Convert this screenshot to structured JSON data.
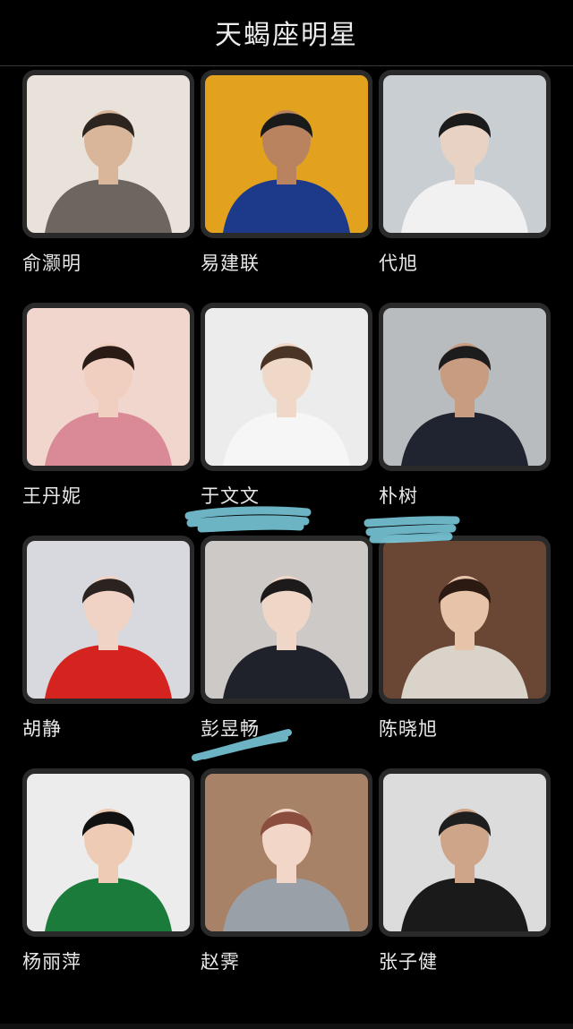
{
  "header": {
    "title": "天蝎座明星"
  },
  "celebrities": [
    {
      "name": "俞灏明",
      "bg": "#e8e2da",
      "skin": "#d9b59a",
      "hair": "#2b241f",
      "top": "#6d6560"
    },
    {
      "name": "易建联",
      "bg": "#e2a21e",
      "skin": "#b98360",
      "hair": "#1a1a1a",
      "top": "#1d3a8a"
    },
    {
      "name": "代旭",
      "bg": "#c9ced3",
      "skin": "#e7d2c4",
      "hair": "#1b1b1b",
      "top": "#f1f1f1"
    },
    {
      "name": "王丹妮",
      "bg": "#f0d6cc",
      "skin": "#f1cfc0",
      "hair": "#2a1b16",
      "top": "#d98a96"
    },
    {
      "name": "于文文",
      "bg": "#ececec",
      "skin": "#f0d8c8",
      "hair": "#4a3426",
      "top": "#f6f6f6"
    },
    {
      "name": "朴树",
      "bg": "#b9bcbf",
      "skin": "#c79c80",
      "hair": "#1c1c1c",
      "top": "#1f2430"
    },
    {
      "name": "胡静",
      "bg": "#d7d9de",
      "skin": "#f0d3c5",
      "hair": "#2a2320",
      "top": "#d5231f"
    },
    {
      "name": "彭昱畅",
      "bg": "#cdc9c6",
      "skin": "#f0d6c6",
      "hair": "#1c1a1a",
      "top": "#20222b"
    },
    {
      "name": "陈晓旭",
      "bg": "#6a4734",
      "skin": "#e6c3a9",
      "hair": "#2b1a12",
      "top": "#dad3ca"
    },
    {
      "name": "杨丽萍",
      "bg": "#ececec",
      "skin": "#edcbb4",
      "hair": "#111111",
      "top": "#1a7b3a"
    },
    {
      "name": "赵霁",
      "bg": "#a88266",
      "skin": "#f2d7c9",
      "hair": "#8a4d3e",
      "top": "#9aa0a8"
    },
    {
      "name": "张子健",
      "bg": "#dcdcdc",
      "skin": "#cfa58a",
      "hair": "#1e1e1e",
      "top": "#1a1a1a"
    }
  ],
  "colors": {
    "page_bg": "#000000",
    "card_frame": "#2a2a2a",
    "text": "#e8e8e8",
    "scribble": "#7fd3e6"
  }
}
